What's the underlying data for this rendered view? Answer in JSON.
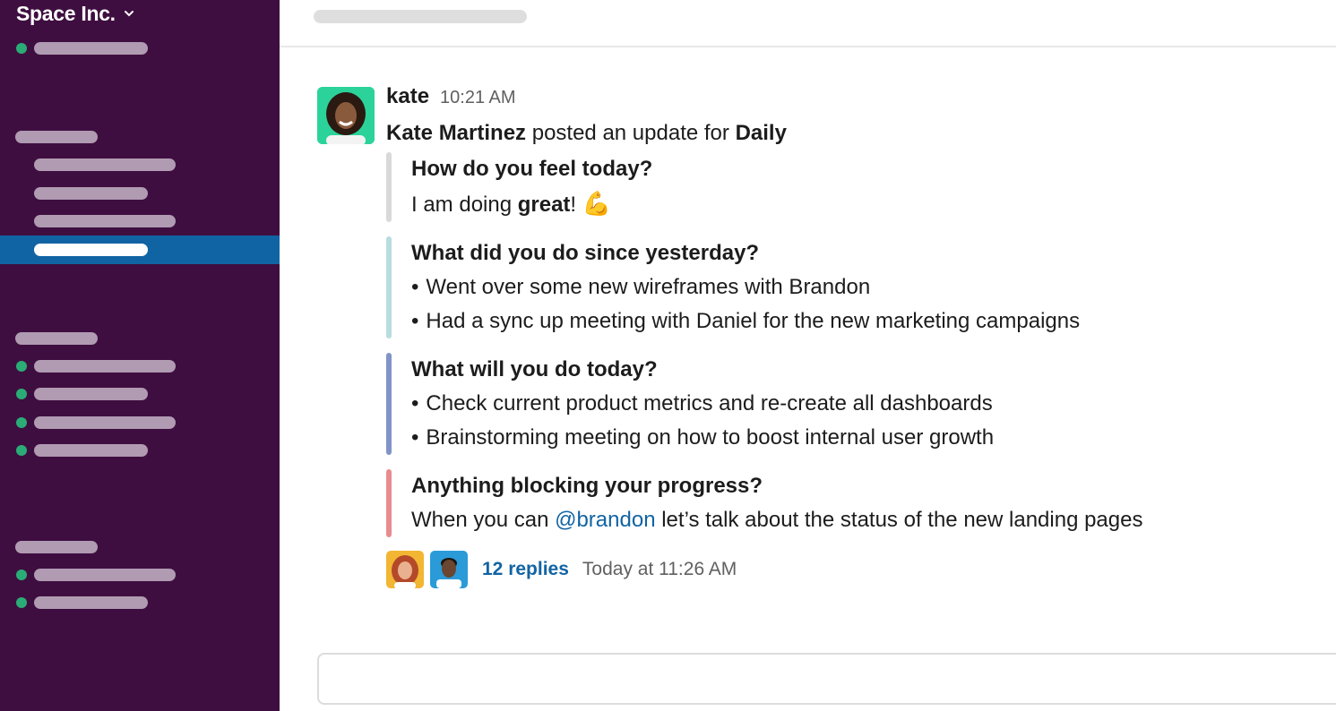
{
  "workspace": {
    "name": "Space Inc.",
    "chevron_icon": "chevron-down-icon"
  },
  "colors": {
    "sidebar_bg": "#3f0e40",
    "sidebar_active": "#1164a3",
    "presence": "#2bac76",
    "link": "#1264a3",
    "rail_feel": "#d9d9d9",
    "rail_yesterday": "#b7dde0",
    "rail_today": "#8194c6",
    "rail_blocking": "#e88c8f"
  },
  "message": {
    "author": "kate",
    "time": "10:21 AM",
    "poster": "Kate Martinez",
    "posted_text": " posted an update for ",
    "report": "Daily",
    "sections": [
      {
        "question": "How do you feel today?",
        "answer_prefix": "I am doing ",
        "answer_bold": "great",
        "answer_suffix": "! ",
        "emoji": "💪"
      },
      {
        "question": "What did you do since yesterday?",
        "items": [
          "Went over some new wireframes with Brandon",
          "Had a sync up meeting with Daniel for the new marketing campaigns"
        ]
      },
      {
        "question": "What will you do today?",
        "items": [
          "Check current product metrics and re-create all dashboards",
          "Brainstorming meeting on how to boost internal user growth"
        ]
      },
      {
        "question": "Anything blocking your progress?",
        "answer_prefix": "When you can ",
        "mention": "@brandon",
        "answer_suffix": " let’s talk about the status of the new landing pages"
      }
    ],
    "thread": {
      "replies": "12 replies",
      "last_reply": "Today at 11:26 AM"
    }
  }
}
